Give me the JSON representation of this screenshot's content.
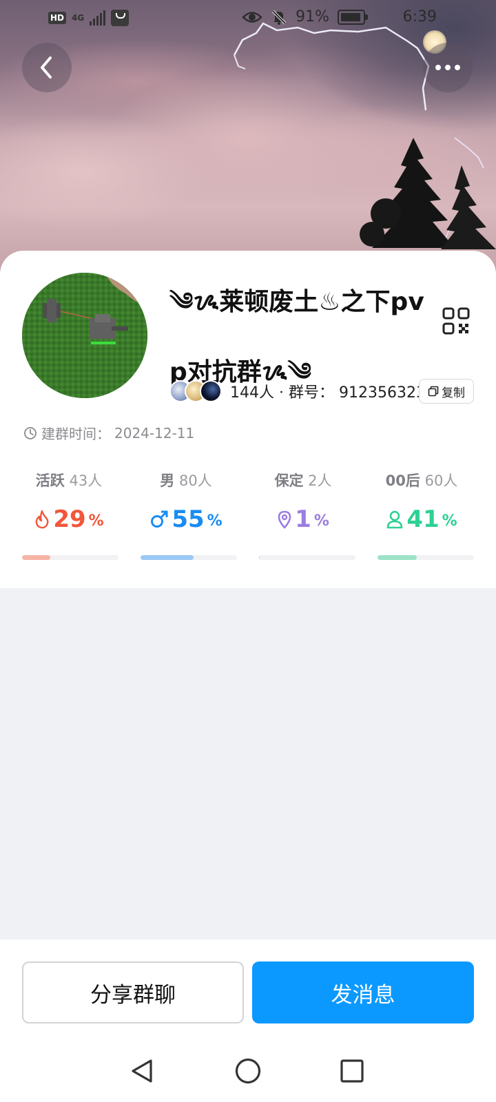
{
  "status_bar": {
    "hd": "HD",
    "network": "4G",
    "battery": "91%",
    "time": "6:39"
  },
  "group": {
    "name": "༄ᝰ莱顿废土♨之下pvp对抗群ᝰ༄",
    "member_count": "144人",
    "separator": "·",
    "id_label": "群号：",
    "id_value": "912356323",
    "copy_label": "复制",
    "created_label": "建群时间：",
    "created_date": "2024-12-11"
  },
  "stats": [
    {
      "title": "活跃",
      "count": "43人",
      "value": "29",
      "unit": "%",
      "fraction": 0.29,
      "color": "#f2563b",
      "bar_color": "#f6b4a6"
    },
    {
      "title": "男",
      "count": "80人",
      "value": "55",
      "unit": "%",
      "fraction": 0.55,
      "color": "#1a8cf2",
      "bar_color": "#9cc9f6"
    },
    {
      "title": "保定",
      "count": "2人",
      "value": "1",
      "unit": "%",
      "fraction": 0.01,
      "color": "#9b7de0",
      "bar_color": "#c8b8ee"
    },
    {
      "title": "00后",
      "count": "60人",
      "value": "41",
      "unit": "%",
      "fraction": 0.41,
      "color": "#2ed194",
      "bar_color": "#9be3c6"
    }
  ],
  "actions": {
    "share": "分享群聊",
    "send": "发消息"
  },
  "icons": {
    "back": "chevron-left-icon",
    "more": "more-dots-icon",
    "qr": "qr-code-icon",
    "copy": "copy-icon",
    "clock": "clock-icon"
  }
}
